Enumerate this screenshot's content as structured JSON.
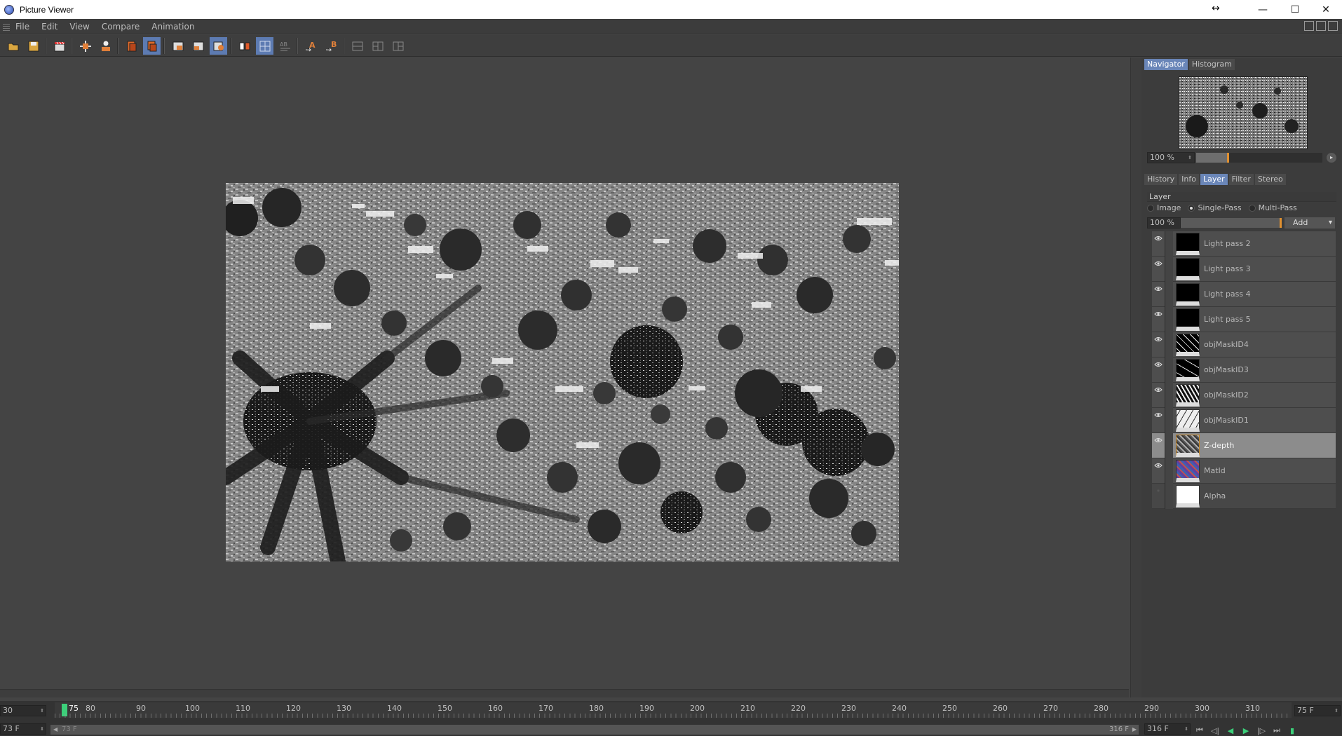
{
  "window": {
    "title": "Picture Viewer",
    "minimize": "—",
    "maximize": "☐",
    "close": "✕",
    "resize": "↔"
  },
  "menu": [
    "File",
    "Edit",
    "View",
    "Compare",
    "Animation"
  ],
  "toolbar": {
    "icons": [
      "open-icon",
      "save-icon",
      "clapper-icon",
      "render-region-icon",
      "render-person-icon",
      "layer-copy-icon",
      "layer-stack-icon",
      "view-a-icon",
      "view-b-icon",
      "compare-icon",
      "ab-toggle-icon",
      "grid-icon",
      "text-ab-icon",
      "set-a-icon",
      "set-b-icon",
      "split-icon",
      "split-h-icon",
      "split-v-icon"
    ]
  },
  "navigator": {
    "tabs": [
      "Navigator",
      "Histogram"
    ],
    "active_tab": "Navigator",
    "zoom": "100 %",
    "zoom_level": 0.25
  },
  "panel_tabs": {
    "tabs": [
      "History",
      "Info",
      "Layer",
      "Filter",
      "Stereo"
    ],
    "active_tab": "Layer"
  },
  "layer_panel": {
    "header": "Layer",
    "modes": [
      "Image",
      "Single-Pass",
      "Multi-Pass"
    ],
    "selected_mode": "Single-Pass",
    "opacity": "100 %",
    "add_label": "Add",
    "layers": [
      {
        "name": "Light pass 2",
        "visible": true,
        "selected": false
      },
      {
        "name": "Light pass 3",
        "visible": true,
        "selected": false
      },
      {
        "name": "Light pass 4",
        "visible": true,
        "selected": false
      },
      {
        "name": "Light pass 5",
        "visible": true,
        "selected": false
      },
      {
        "name": "objMaskID4",
        "visible": true,
        "selected": false
      },
      {
        "name": "objMaskID3",
        "visible": true,
        "selected": false
      },
      {
        "name": "objMaskID2",
        "visible": true,
        "selected": false
      },
      {
        "name": "objMaskID1",
        "visible": true,
        "selected": false
      },
      {
        "name": "Z-depth",
        "visible": true,
        "selected": true
      },
      {
        "name": "MatId",
        "visible": true,
        "selected": false
      },
      {
        "name": "Alpha",
        "visible": false,
        "selected": false
      }
    ]
  },
  "timeline": {
    "start_field": "30",
    "playhead_label": "75",
    "end_field": "75 F",
    "current_frame": "73 F",
    "range_start": "73 F",
    "range_end": "316 F",
    "total_field": "316 F",
    "ruler_labels": [
      "80",
      "90",
      "100",
      "110",
      "120",
      "130",
      "140",
      "150",
      "160",
      "170",
      "180",
      "190",
      "200",
      "210",
      "220",
      "230",
      "240",
      "250",
      "260",
      "270",
      "280",
      "290",
      "300",
      "310"
    ]
  }
}
